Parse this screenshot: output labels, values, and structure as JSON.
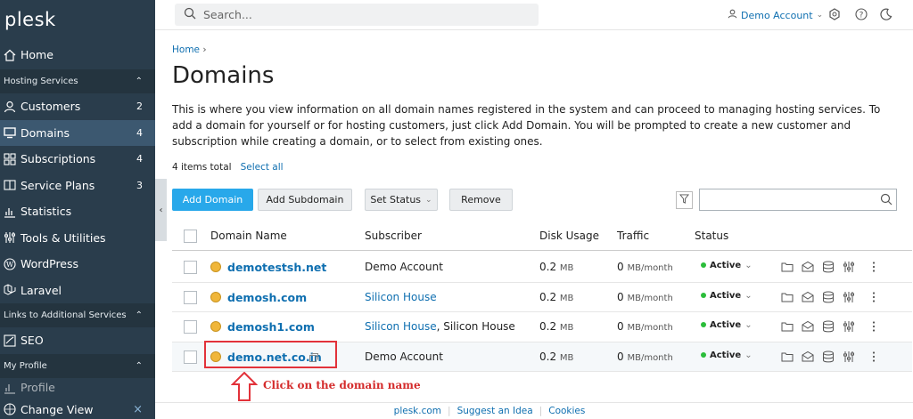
{
  "sidebar": {
    "logo": "plesk",
    "home": "Home",
    "hosting_section": "Hosting Services",
    "items": [
      {
        "label": "Customers",
        "count": "2",
        "icon": "user-icon"
      },
      {
        "label": "Domains",
        "count": "4",
        "icon": "monitor-icon"
      },
      {
        "label": "Subscriptions",
        "count": "4",
        "icon": "grid-icon"
      },
      {
        "label": "Service Plans",
        "count": "3",
        "icon": "book-icon"
      },
      {
        "label": "Statistics",
        "count": "",
        "icon": "bar-chart-icon"
      },
      {
        "label": "Tools & Utilities",
        "count": "",
        "icon": "sliders-icon"
      },
      {
        "label": "WordPress",
        "count": "",
        "icon": "wordpress-icon"
      },
      {
        "label": "Laravel",
        "count": "",
        "icon": "laravel-icon"
      }
    ],
    "links_section": "Links to Additional Services",
    "seo": "SEO",
    "profile_section": "My Profile",
    "profile": "Profile",
    "change_view": "Change View"
  },
  "topbar": {
    "search_placeholder": "Search...",
    "account": "Demo Account"
  },
  "page": {
    "breadcrumb": "Home",
    "title": "Domains",
    "description": "This is where you view information on all domain names registered in the system and can proceed to managing hosting services. To add a domain for yourself or for hosting customers, just click Add Domain. You will be prompted to create a new customer and subscription while creating a domain, or to select from existing ones.",
    "items_total": "4 items total",
    "select_all": "Select all"
  },
  "toolbar": {
    "add_domain": "Add Domain",
    "add_subdomain": "Add Subdomain",
    "set_status": "Set Status",
    "remove": "Remove"
  },
  "table": {
    "headers": {
      "domain": "Domain Name",
      "subscriber": "Subscriber",
      "disk": "Disk Usage",
      "traffic": "Traffic",
      "status": "Status"
    },
    "rows": [
      {
        "domain": "demotestsh.net",
        "subscriber": "Demo Account",
        "subscriber_link": false,
        "subscriber_extra": "",
        "disk": "0.2",
        "disk_unit": "MB",
        "traffic": "0",
        "traffic_unit": "MB/month",
        "status": "Active"
      },
      {
        "domain": "demosh.com",
        "subscriber": "Silicon House",
        "subscriber_link": true,
        "subscriber_extra": "",
        "disk": "0.2",
        "disk_unit": "MB",
        "traffic": "0",
        "traffic_unit": "MB/month",
        "status": "Active"
      },
      {
        "domain": "demosh1.com",
        "subscriber": "Silicon House",
        "subscriber_link": true,
        "subscriber_extra": ", Silicon House",
        "disk": "0.2",
        "disk_unit": "MB",
        "traffic": "0",
        "traffic_unit": "MB/month",
        "status": "Active"
      },
      {
        "domain": "demo.net.co.in",
        "subscriber": "Demo Account",
        "subscriber_link": false,
        "subscriber_extra": "",
        "disk": "0.2",
        "disk_unit": "MB",
        "traffic": "0",
        "traffic_unit": "MB/month",
        "status": "Active"
      }
    ]
  },
  "annotation": "Click on the domain name",
  "footer": {
    "link1": "plesk.com",
    "link2": "Suggest an Idea",
    "link3": "Cookies"
  },
  "colors": {
    "sidebar_bg": "#2a3d4c",
    "accent": "#28a8ea",
    "link": "#0f6fb0",
    "annotation_red": "#e2323a",
    "active_green": "#2bbd3a"
  }
}
